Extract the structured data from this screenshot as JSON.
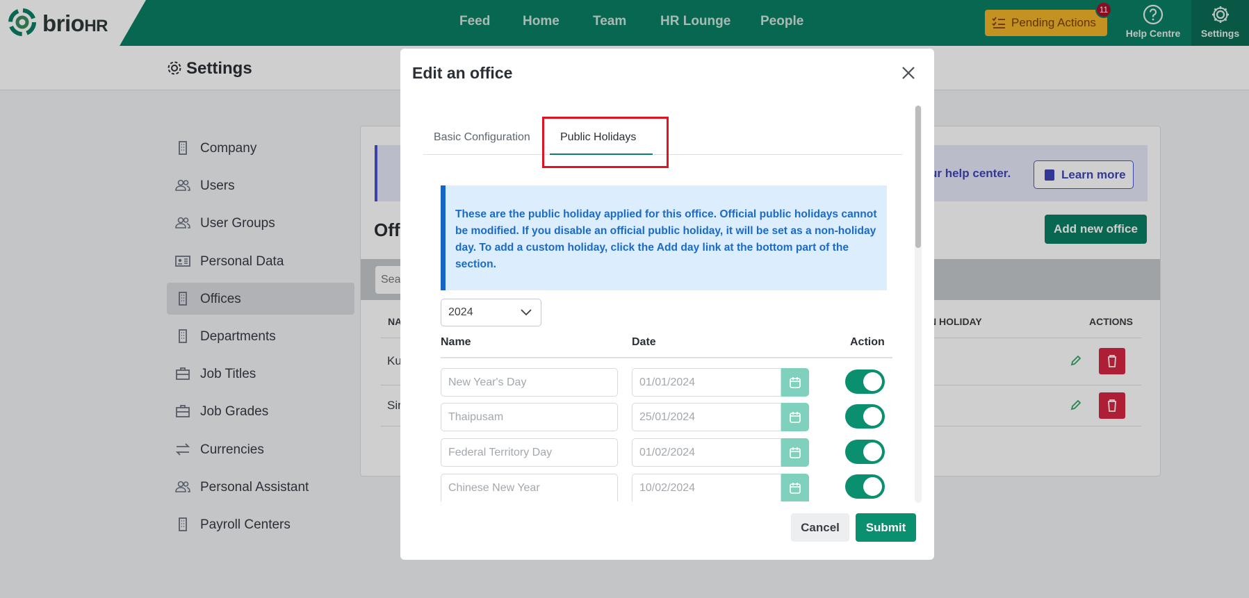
{
  "topbar": {
    "brand_main": "brio",
    "brand_suffix": "HR",
    "nav": [
      "Feed",
      "Home",
      "Team",
      "HR Lounge",
      "People"
    ],
    "pending_label": "Pending Actions",
    "pending_count": "11",
    "help_label": "Help Centre",
    "settings_label": "Settings",
    "pending_color": "#f0b429",
    "brand_color": "#0a7f64"
  },
  "subheader": {
    "title": "Settings"
  },
  "sidebar": {
    "items": [
      {
        "label": "Company",
        "icon": "building-icon"
      },
      {
        "label": "Users",
        "icon": "users-icon"
      },
      {
        "label": "User Groups",
        "icon": "users-icon"
      },
      {
        "label": "Personal Data",
        "icon": "id-card-icon"
      },
      {
        "label": "Offices",
        "icon": "building-icon",
        "active": true
      },
      {
        "label": "Departments",
        "icon": "building-icon"
      },
      {
        "label": "Job Titles",
        "icon": "briefcase-icon"
      },
      {
        "label": "Job Grades",
        "icon": "briefcase-icon"
      },
      {
        "label": "Currencies",
        "icon": "exchange-icon"
      },
      {
        "label": "Personal Assistant",
        "icon": "users-icon"
      },
      {
        "label": "Payroll Centers",
        "icon": "building-icon"
      }
    ]
  },
  "main": {
    "banner_text": "ur help center.",
    "learn_more": "Learn more",
    "offices_title": "Offi",
    "add_office": "Add new office",
    "search_placeholder": "Sea",
    "col_name": "NA",
    "col_holiday": "N HOLIDAY",
    "col_actions": "ACTIONS",
    "rows": [
      "Ku",
      "Sir"
    ]
  },
  "modal": {
    "title": "Edit an office",
    "tabs": [
      "Basic Configuration",
      "Public Holidays"
    ],
    "active_tab": "Public Holidays",
    "info": "These are the public holiday applied for this office. Official public holidays cannot be modified. If you disable an official public holiday, it will be set as a non-holiday day. To add a custom holiday, click the Add day link at the bottom part of the section.",
    "year": "2024",
    "columns": {
      "name": "Name",
      "date": "Date",
      "action": "Action"
    },
    "holidays": [
      {
        "name": "New Year's Day",
        "date": "01/01/2024",
        "enabled": true
      },
      {
        "name": "Thaipusam",
        "date": "25/01/2024",
        "enabled": true
      },
      {
        "name": "Federal Territory Day",
        "date": "01/02/2024",
        "enabled": true
      },
      {
        "name": "Chinese New Year",
        "date": "10/02/2024",
        "enabled": true
      }
    ],
    "cancel": "Cancel",
    "submit": "Submit"
  }
}
